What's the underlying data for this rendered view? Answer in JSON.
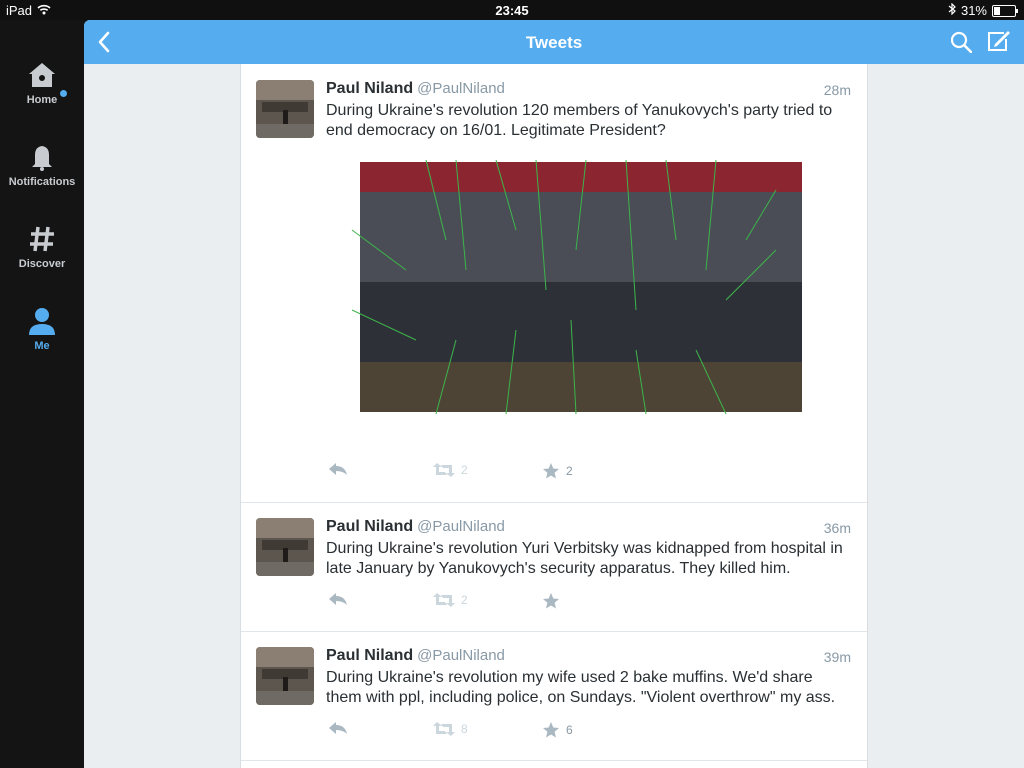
{
  "status_bar": {
    "device": "iPad",
    "time": "23:45",
    "battery_percent": "31%",
    "battery_level": 0.31
  },
  "sidebar": {
    "items": [
      {
        "label": "Home",
        "icon": "home-icon",
        "active": false,
        "has_notification_dot": true
      },
      {
        "label": "Notifications",
        "icon": "bell-icon",
        "active": false
      },
      {
        "label": "Discover",
        "icon": "hashtag-icon",
        "active": false
      },
      {
        "label": "Me",
        "icon": "person-icon",
        "active": true
      }
    ]
  },
  "header": {
    "title": "Tweets",
    "back_icon": "back-chevron-icon",
    "search_icon": "search-icon",
    "compose_icon": "compose-icon"
  },
  "colors": {
    "accent": "#55acee",
    "sidebar_bg": "#141414",
    "timeline_bg": "#ffffff",
    "canvas_bg": "#ebeef0"
  },
  "tweets": [
    {
      "name": "Paul Niland",
      "handle": "@PaulNiland",
      "time": "28m",
      "text": "During Ukraine's revolution 120 members of Yanukovych's party tried to end democracy on 16/01. Legitimate President?",
      "has_media": true,
      "retweets": "2",
      "favorites": "2"
    },
    {
      "name": "Paul Niland",
      "handle": "@PaulNiland",
      "time": "36m",
      "text": "During Ukraine's revolution Yuri Verbitsky was kidnapped from hospital in late January by Yanukovych's security apparatus. They killed him.",
      "has_media": false,
      "retweets": "2",
      "favorites": ""
    },
    {
      "name": "Paul Niland",
      "handle": "@PaulNiland",
      "time": "39m",
      "text": "During Ukraine's revolution my wife used 2 bake muffins. We'd share them with ppl, including police, on Sundays. \"Violent overthrow\" my ass.",
      "has_media": false,
      "retweets": "8",
      "favorites": "6"
    }
  ]
}
